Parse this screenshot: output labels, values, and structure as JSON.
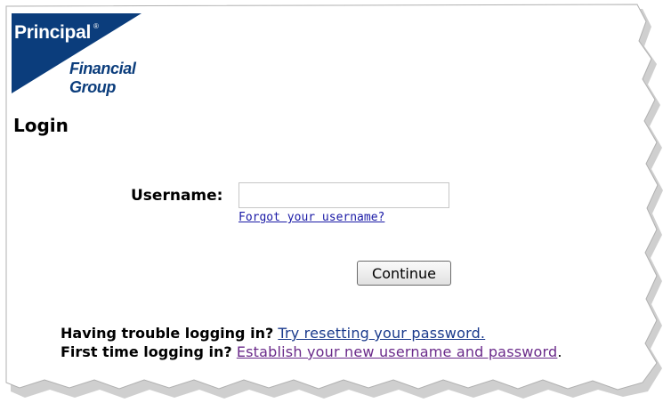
{
  "logo": {
    "brand": "Principal",
    "registered_mark": "®",
    "line1": "Financial",
    "line2": "Group",
    "colors": {
      "navy": "#0b3d7c",
      "white": "#ffffff"
    }
  },
  "page": {
    "title": "Login"
  },
  "form": {
    "username_label": "Username:",
    "username_value": "",
    "forgot_username_link": "Forgot your username?",
    "continue_label": "Continue"
  },
  "help": {
    "trouble_text": "Having trouble logging in?",
    "reset_link": "Try resetting your password.",
    "first_time_text": "First time logging in?",
    "establish_link": "Establish your new username and password",
    "period": "."
  },
  "colors": {
    "link": "#1a3a8c",
    "visited_link": "#6a2a8a",
    "frame_shadow": "#9a9a9a"
  }
}
